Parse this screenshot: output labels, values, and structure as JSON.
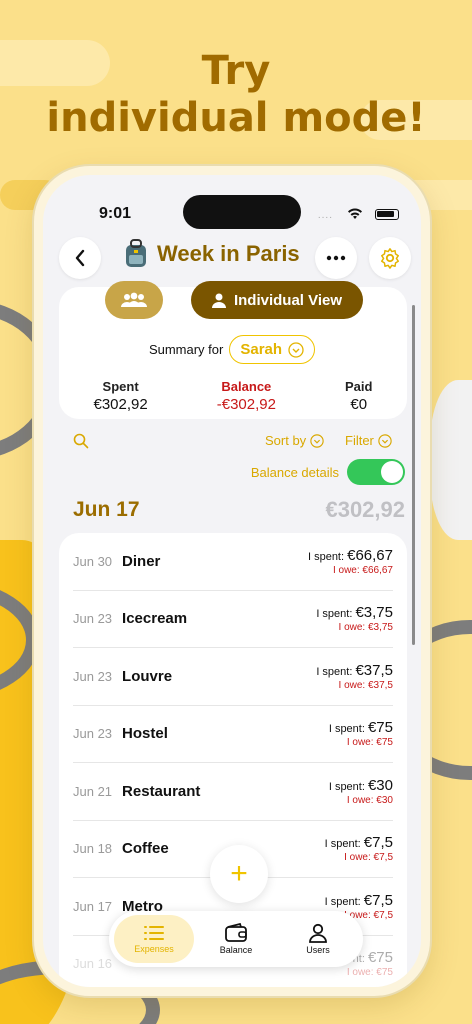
{
  "headline": {
    "line1": "Try",
    "line2": "individual mode!"
  },
  "status": {
    "time": "9:01",
    "signal": "....",
    "wifi": "wifi-icon"
  },
  "header": {
    "title": "Week in Paris",
    "back": "chevron-left-icon",
    "more": "more-icon",
    "settings": "gear-icon"
  },
  "view_toggle": {
    "group_icon": "group-icon",
    "individual_label": "Individual View"
  },
  "summary": {
    "label": "Summary for",
    "person": "Sarah",
    "spent_label": "Spent",
    "spent_value": "€302,92",
    "balance_label": "Balance",
    "balance_value": "-€302,92",
    "paid_label": "Paid",
    "paid_value": "€0"
  },
  "toolbar": {
    "sort_label": "Sort by",
    "filter_label": "Filter",
    "balance_details_label": "Balance details",
    "balance_details_on": true
  },
  "section": {
    "date": "Jun 17",
    "total": "€302,92"
  },
  "expenses": [
    {
      "date": "Jun 30",
      "name": "Diner",
      "spent_prefix": "I spent: ",
      "spent": "€66,67",
      "owe": "I owe: €66,67"
    },
    {
      "date": "Jun 23",
      "name": "Icecream",
      "spent_prefix": "I spent: ",
      "spent": "€3,75",
      "owe": "I owe: €3,75"
    },
    {
      "date": "Jun 23",
      "name": "Louvre",
      "spent_prefix": "I spent: ",
      "spent": "€37,5",
      "owe": "I owe: €37,5"
    },
    {
      "date": "Jun 23",
      "name": "Hostel",
      "spent_prefix": "I spent: ",
      "spent": "€75",
      "owe": "I owe: €75"
    },
    {
      "date": "Jun 21",
      "name": "Restaurant",
      "spent_prefix": "I spent: ",
      "spent": "€30",
      "owe": "I owe: €30"
    },
    {
      "date": "Jun 18",
      "name": "Coffee",
      "spent_prefix": "I spent: ",
      "spent": "€7,5",
      "owe": "I owe: €7,5"
    },
    {
      "date": "Jun 17",
      "name": "Metro",
      "spent_prefix": "I spent: ",
      "spent": "€7,5",
      "owe": "I owe: €7,5"
    },
    {
      "date": "Jun 16",
      "name": "",
      "spent_prefix": "I spent: ",
      "spent": "€75",
      "owe": "I owe: €75"
    }
  ],
  "fab": {
    "label": "+"
  },
  "tabs": [
    {
      "label": "Expenses",
      "icon": "list-icon",
      "active": true
    },
    {
      "label": "Balance",
      "icon": "wallet-icon",
      "active": false
    },
    {
      "label": "Users",
      "icon": "user-icon",
      "active": false
    }
  ],
  "colors": {
    "brand": "#8a6300",
    "accent": "#f0c400",
    "negative": "#c71919",
    "toggle_on": "#34c759"
  }
}
